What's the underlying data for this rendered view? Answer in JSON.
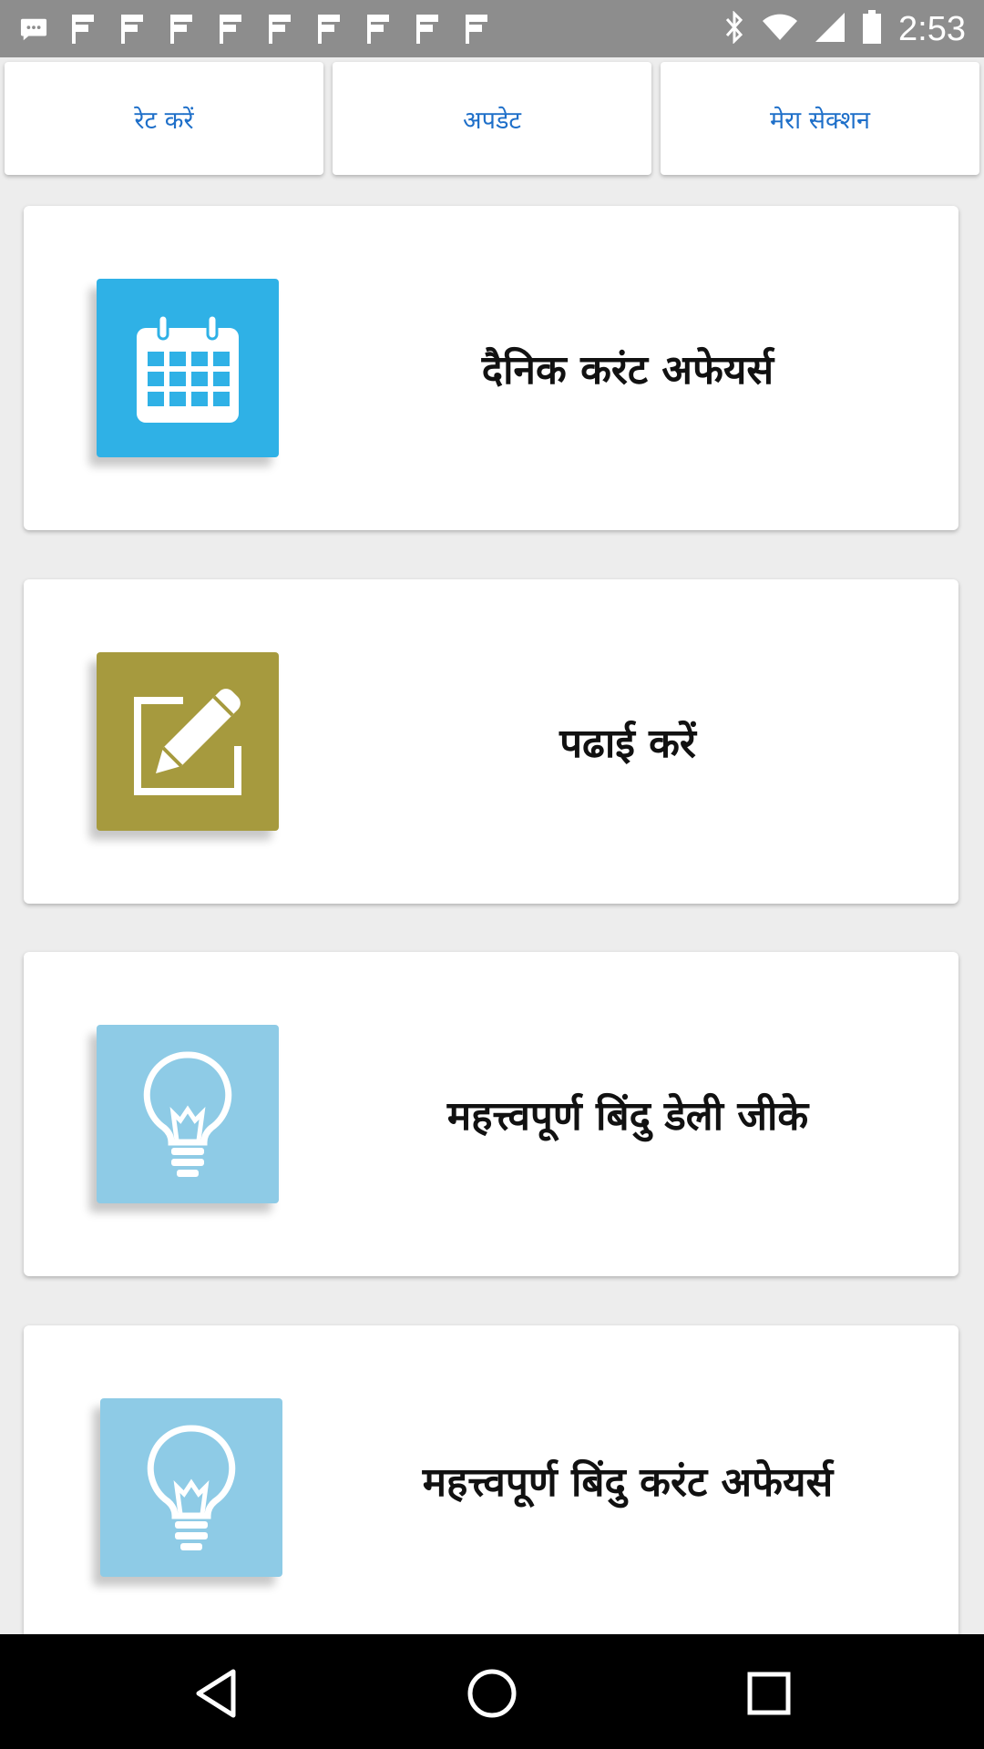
{
  "status_bar": {
    "time": "2:53",
    "notification_icons": [
      "chat-icon",
      "flag-icon",
      "flag-icon",
      "flag-icon",
      "flag-icon",
      "flag-icon",
      "flag-icon",
      "flag-icon",
      "flag-icon",
      "flag-icon"
    ],
    "system_icons": [
      "bluetooth-icon",
      "wifi-icon",
      "signal-icon",
      "battery-icon"
    ]
  },
  "top_buttons": [
    {
      "label": "रेट करें"
    },
    {
      "label": "अपडेट"
    },
    {
      "label": "मेरा सेक्शन"
    }
  ],
  "cards": [
    {
      "title": "दैनिक करंट अफेयर्स",
      "icon": "calendar-icon",
      "icon_color": "#2fb1e6"
    },
    {
      "title": "पढाई करें",
      "icon": "edit-icon",
      "icon_color": "#a69a3e"
    },
    {
      "title": "महत्त्वपूर्ण बिंदु डेली जीके",
      "icon": "lightbulb-icon",
      "icon_color": "#8ecbe6"
    },
    {
      "title": "महत्त्वपूर्ण बिंदु करंट अफेयर्स",
      "icon": "lightbulb-icon",
      "icon_color": "#8ecbe6"
    }
  ],
  "nav_bar": [
    "back-icon",
    "home-icon",
    "recents-icon"
  ]
}
